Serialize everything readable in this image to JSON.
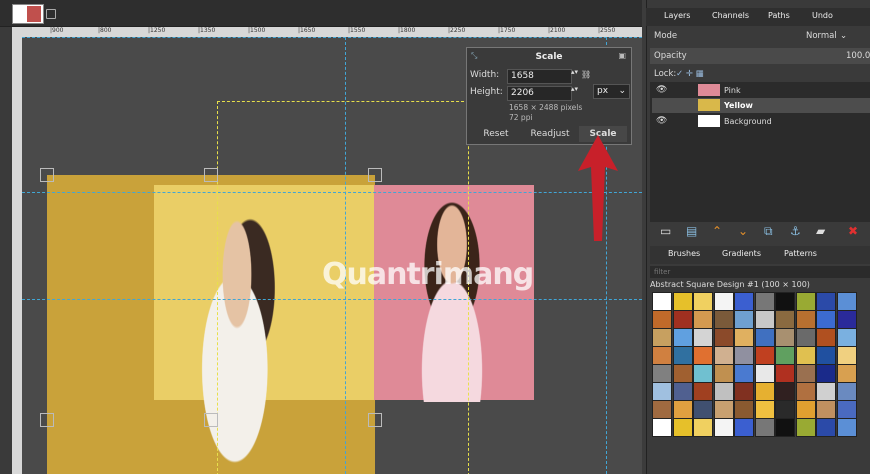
{
  "ruler": {
    "h_ticks": [
      "|900",
      "|800",
      "|1250",
      "|1350",
      "|1500",
      "|1650",
      "|1550",
      "|1800",
      "|2250",
      "|1750",
      "|2100",
      "|2550"
    ]
  },
  "scale_dialog": {
    "title": "Scale",
    "width_label": "Width:",
    "width_value": "1658",
    "height_label": "Height:",
    "height_value": "2206",
    "info_pixels": "1658 × 2488 pixels",
    "info_ppi": "72 ppi",
    "unit": "px",
    "reset_label": "Reset",
    "readjust_label": "Readjust",
    "scale_label": "Scale"
  },
  "panel_tabs": [
    "Layers",
    "Channels",
    "Paths",
    "Undo"
  ],
  "mode": {
    "label": "Mode",
    "value": "Normal"
  },
  "opacity": {
    "label": "Opacity",
    "value": "100.0"
  },
  "lock_label": "Lock:",
  "layers": [
    {
      "name": "Pink",
      "visible": true
    },
    {
      "name": "Yellow",
      "visible": false
    },
    {
      "name": "Background",
      "visible": true
    }
  ],
  "brush_tabs": [
    "Brushes",
    "Gradients",
    "Patterns"
  ],
  "filter_placeholder": "filter",
  "pattern_name": "Abstract Square Design #1 (100 × 100)",
  "watermark": "Quantrimang",
  "colors": {
    "yellow_photo": "#d9b84a",
    "pink_photo": "#e0879a",
    "guide": "#41a6d6",
    "arrow": "#c8202a"
  }
}
